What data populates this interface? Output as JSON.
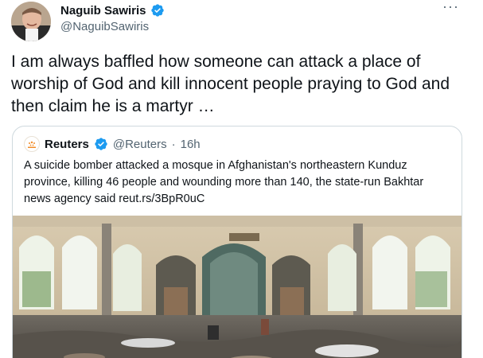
{
  "author": {
    "display_name": "Naguib Sawiris",
    "handle": "@NaguibSawiris",
    "avatar_icon": "avatar-photo",
    "verified_icon": "verified-badge-icon"
  },
  "menu_icon": "more-options-icon",
  "menu_glyph": "···",
  "tweet": {
    "text": "I am always baffled how someone can attack a place of worship of God and kill innocent people praying to God and then claim he is a martyr …"
  },
  "quoted_tweet": {
    "display_name": "Reuters",
    "handle": "@Reuters",
    "separator": "·",
    "time": "16h",
    "text": "A suicide bomber attacked a mosque in Afghanistan's northeastern Kunduz province, killing 46 people and wounding more than 140, the state-run Bakhtar news agency said reut.rs/3BpR0uC",
    "logo_icon": "reuters-logo-icon",
    "media_description_icon": "mosque-interior-photo"
  },
  "colors": {
    "verified_blue": "#1d9bf0",
    "secondary_text": "#536471",
    "border": "#cfd9de"
  }
}
